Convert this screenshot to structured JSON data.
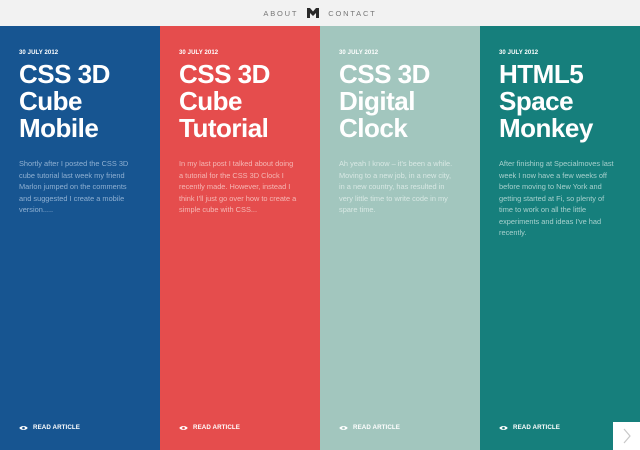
{
  "nav": {
    "about": "ABOUT",
    "contact": "CONTACT"
  },
  "colors": {
    "blue": "#175591",
    "red": "#e54d4d",
    "sage": "#a2c6be",
    "teal": "#167f7c"
  },
  "articles": [
    {
      "date": "30 JULY 2012",
      "title": "CSS 3D\nCube\nMobile",
      "excerpt": "Shortly after I posted the CSS 3D cube tutorial last week my friend Marlon jumped on the comments and suggested I create a mobile version.....",
      "read": "READ ARTICLE",
      "excerpt_color": "#8fb0d2"
    },
    {
      "date": "30 JULY 2012",
      "title": "CSS 3D\nCube\nTutorial",
      "excerpt": "In my last post I talked about doing a tutorial for the CSS 3D Clock I recently made. However, instead I think I'll just go over how to create a simple cube with CSS...",
      "read": "READ ARTICLE",
      "excerpt_color": "#f5b7b4"
    },
    {
      "date": "30 JULY 2012",
      "title": "CSS 3D\nDigital\nClock",
      "excerpt": "Ah yeah I know – it's been a while. Moving to a new job, in a new city, in a new country, has resulted in very little time to write code in my spare time.",
      "read": "READ ARTICLE",
      "excerpt_color": "#d8e8e4"
    },
    {
      "date": "30 JULY 2012",
      "title": "HTML5\nSpace\nMonkey",
      "excerpt": "After finishing at Specialmoves last week I now have a few weeks off before moving to New York and getting started at Fi, so plenty of time to work on all the little experiments and ideas I've had recently.",
      "read": "READ ARTICLE",
      "excerpt_color": "#a8d1ce"
    }
  ],
  "icons": {
    "logo": "monogram-logo-icon",
    "read": "eye-icon",
    "next": "chevron-right-icon"
  }
}
